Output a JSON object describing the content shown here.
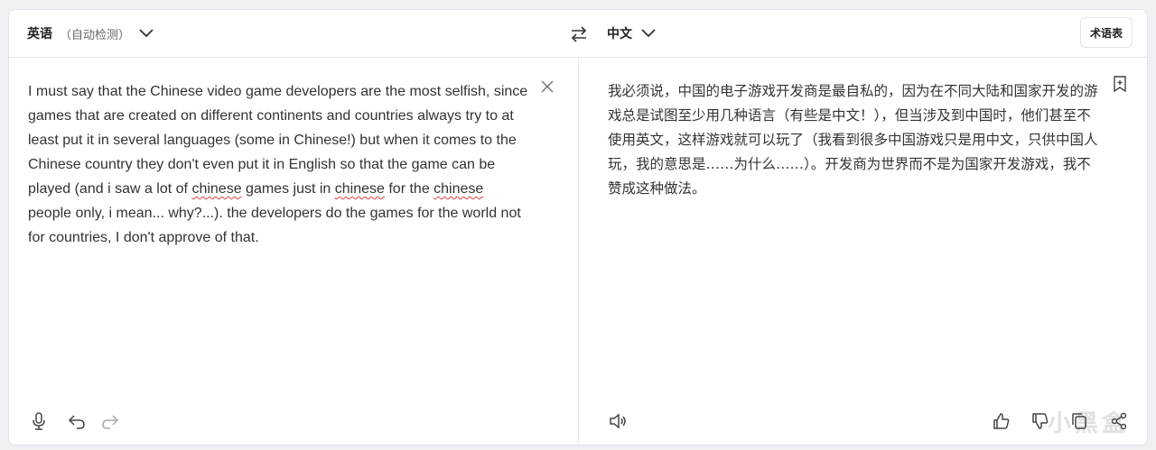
{
  "header": {
    "source_language": "英语",
    "source_auto_label": "（自动检测）",
    "target_language": "中文",
    "glossary_button": "术语表"
  },
  "source": {
    "segments": [
      {
        "text": "I must say that the Chinese video game developers are the most selfish, since games that are created on different continents and countries always try to at least put it in several languages (some in Chinese!) but when it comes to the Chinese country they don't even put it in English so that the game can be played (and i saw a lot of ",
        "misspelled": false
      },
      {
        "text": "chinese",
        "misspelled": true
      },
      {
        "text": " games just in ",
        "misspelled": false
      },
      {
        "text": "chinese",
        "misspelled": true
      },
      {
        "text": " for the ",
        "misspelled": false
      },
      {
        "text": "chinese",
        "misspelled": true
      },
      {
        "text": " people only, i mean... why?...). the developers do the games for the world not for countries, I don't approve of that.",
        "misspelled": false
      }
    ]
  },
  "translation": {
    "text": "我必须说，中国的电子游戏开发商是最自私的，因为在不同大陆和国家开发的游戏总是试图至少用几种语言（有些是中文！），但当涉及到中国时，他们甚至不使用英文，这样游戏就可以玩了（我看到很多中国游戏只是用中文，只供中国人玩，我的意思是……为什么……）。开发商为世界而不是为国家开发游戏，我不赞成这种做法。"
  },
  "icons": {
    "source_toolbar": [
      "microphone-icon",
      "undo-icon",
      "redo-icon"
    ],
    "target_toolbar": [
      "speaker-icon",
      "thumbs-up-icon",
      "thumbs-down-icon",
      "copy-icon",
      "share-icon"
    ],
    "header": [
      "chevron-down-icon",
      "swap-icon"
    ],
    "misc": [
      "close-icon",
      "bookmark-add-icon"
    ]
  },
  "watermark": "小黑盒",
  "colors": {
    "background": "#eef0f3",
    "card": "#ffffff",
    "text": "#333333",
    "spellcheck": "#e04040"
  }
}
